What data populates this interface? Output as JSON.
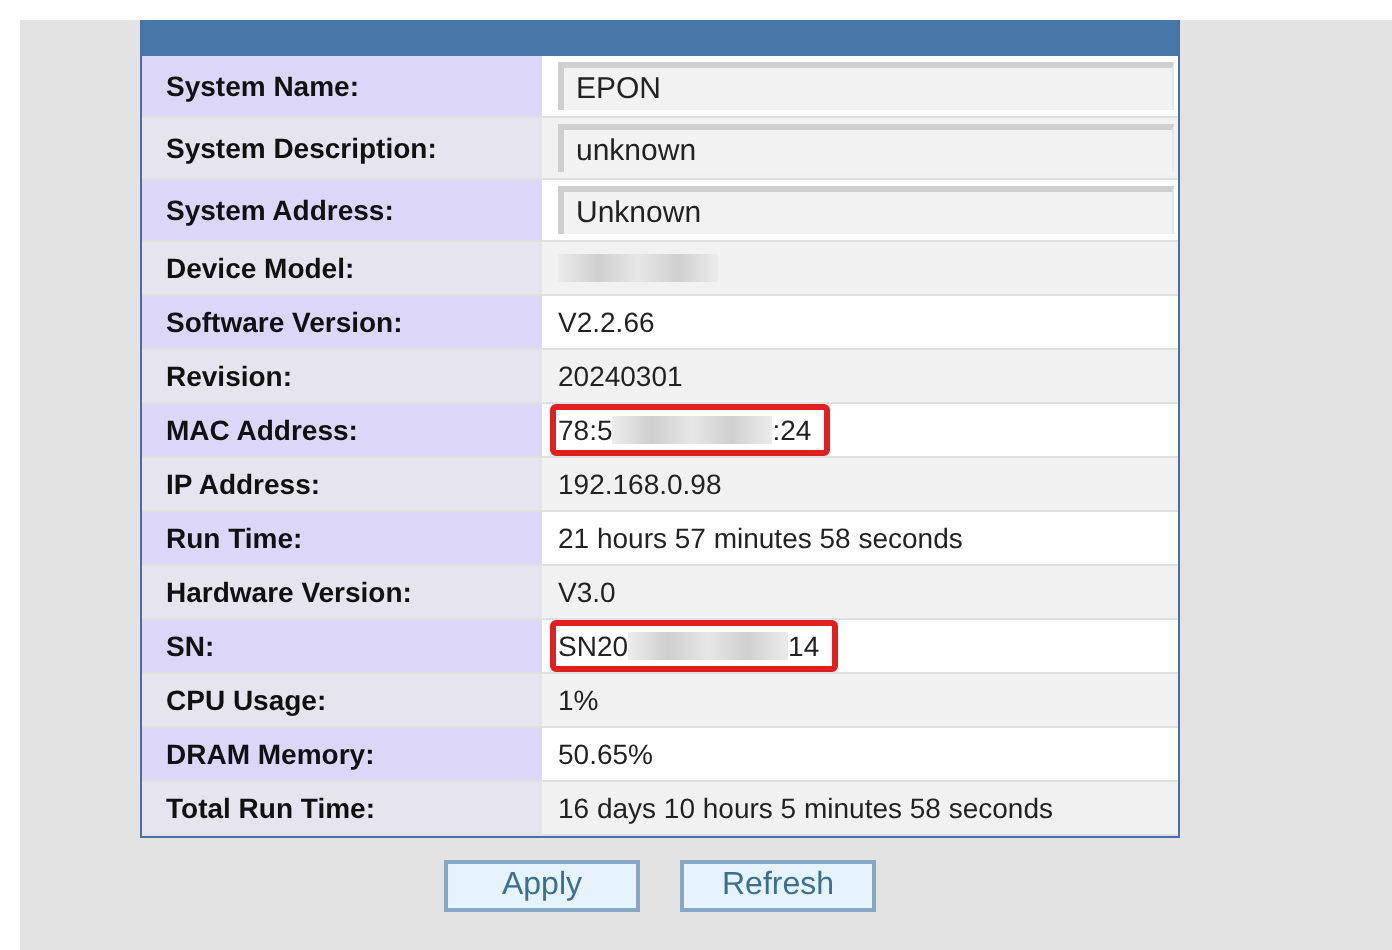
{
  "rows": [
    {
      "label": "System Name:",
      "kind": "input",
      "segments": [
        {
          "kind": "text",
          "text": "EPON"
        }
      ],
      "highlighted": false
    },
    {
      "label": "System Description:",
      "kind": "input",
      "segments": [
        {
          "kind": "text",
          "text": "unknown"
        }
      ],
      "highlighted": false
    },
    {
      "label": "System Address:",
      "kind": "input",
      "segments": [
        {
          "kind": "text",
          "text": "Unknown"
        }
      ],
      "highlighted": false
    },
    {
      "label": "Device Model:",
      "kind": "text",
      "segments": [
        {
          "kind": "blurred"
        }
      ],
      "highlighted": false
    },
    {
      "label": "Software Version:",
      "kind": "text",
      "segments": [
        {
          "kind": "text",
          "text": "V2.2.66"
        }
      ],
      "highlighted": false
    },
    {
      "label": "Revision:",
      "kind": "text",
      "segments": [
        {
          "kind": "text",
          "text": "20240301"
        }
      ],
      "highlighted": false
    },
    {
      "label": "MAC Address:",
      "kind": "text",
      "segments": [
        {
          "kind": "text",
          "text": "78:5"
        },
        {
          "kind": "blurred"
        },
        {
          "kind": "text",
          "text": ":24"
        }
      ],
      "highlighted": true
    },
    {
      "label": "IP Address:",
      "kind": "text",
      "segments": [
        {
          "kind": "text",
          "text": "192.168.0.98"
        }
      ],
      "highlighted": false
    },
    {
      "label": "Run Time:",
      "kind": "text",
      "segments": [
        {
          "kind": "text",
          "text": "21 hours 57 minutes 58 seconds"
        }
      ],
      "highlighted": false
    },
    {
      "label": "Hardware Version:",
      "kind": "text",
      "segments": [
        {
          "kind": "text",
          "text": "V3.0"
        }
      ],
      "highlighted": false
    },
    {
      "label": "SN:",
      "kind": "text",
      "segments": [
        {
          "kind": "text",
          "text": "SN20"
        },
        {
          "kind": "blurred"
        },
        {
          "kind": "text",
          "text": "14"
        }
      ],
      "highlighted": true
    },
    {
      "label": "CPU Usage:",
      "kind": "text",
      "segments": [
        {
          "kind": "text",
          "text": "1%"
        }
      ],
      "highlighted": false
    },
    {
      "label": "DRAM Memory:",
      "kind": "text",
      "segments": [
        {
          "kind": "text",
          "text": "50.65%"
        }
      ],
      "highlighted": false
    },
    {
      "label": "Total Run Time:",
      "kind": "text",
      "segments": [
        {
          "kind": "text",
          "text": "16 days 10 hours 5 minutes 58 seconds"
        }
      ],
      "highlighted": false
    }
  ],
  "buttons": [
    "Apply",
    "Refresh"
  ]
}
